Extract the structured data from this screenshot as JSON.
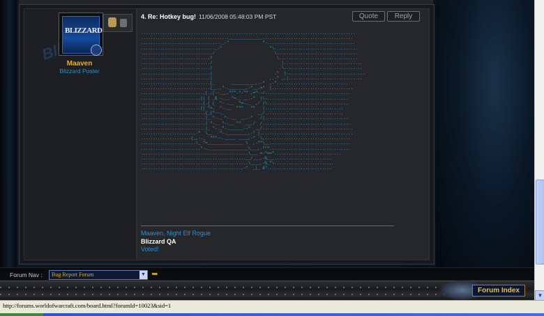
{
  "post": {
    "number_title": "4. Re: Hotkey bug!",
    "date": "11/06/2008 05:48:03 PM PST",
    "quote_label": "Quote",
    "reply_label": "Reply",
    "ascii_art": "..........................................................................................\n.....................................______________......................................\n.................................._-\"              \"-.....................................\n..............................._-\"                    \"\\...................................\n............................../                         \\..................................\n.............................?                           \\.................................\n............................./                             |.................................\n.............................|                            .\\.................................\n.............................|                          .\"  ).................................\n.............................|                        ,.-\" _.|...............................\n.............................(_       __________,.-\"  ,-\"..............................\n.............................(__.,\"-._______,-\"__.=\"  (..................................\n..........................,(.,(--___,\"\"\"-\"-\"\" ,=\"--/....................................\n.........................(( ( _$ -.__ \"=._ __.-\"  |\\...................................\n..........................(.( (  \"- .__  \"=-._  ,/ |\\..................................\n.........................(( \"=.  \"-.__  \"\"\"   \"\"   |.................................\n...........................(_(\"--._              __/.................................\n...........................|_ \"-._ \"-.__  __.-\"   /|...................................\n...........................| \"-._ \"-.__ \"\"  ___/  /.....................................\n...........................|_ \"-._\"-.______--\"  __/......................................\n......................,-\"  \\__   \"-._________,-\" |.......................................\n.....................(_,-._  \"\"\"--._____ ____,-\"  \\,....................................\n.......................\\_ \"=_______________ \\  ,-\"\"\\__..................................\n.........................\"-._________________\\___,-\"\"\"..................................\n.............................................\\___ =-\"==\"............................\n............................................__/___,-%___........................\n.............................................\\____,-%_\"\\.........................\n..........................................,-\"  _|_ &\"..........................."
  },
  "author": {
    "name": "Maaven",
    "title": "Blizzard Poster",
    "avatar_text": "BLIZZARD",
    "watermark": "Blizzard"
  },
  "signature": {
    "line1": "Maaven, Night Elf Rogue",
    "line2": "Blizzard QA",
    "line3": "Voted!"
  },
  "nav": {
    "label": "Forum Nav :",
    "selected_forum": "Bug Report Forum",
    "forum_index_label": "Forum Index"
  },
  "status_bar": {
    "url": "http://forums.worldofwarcraft.com/board.html?forumId=10023&sid=1"
  }
}
